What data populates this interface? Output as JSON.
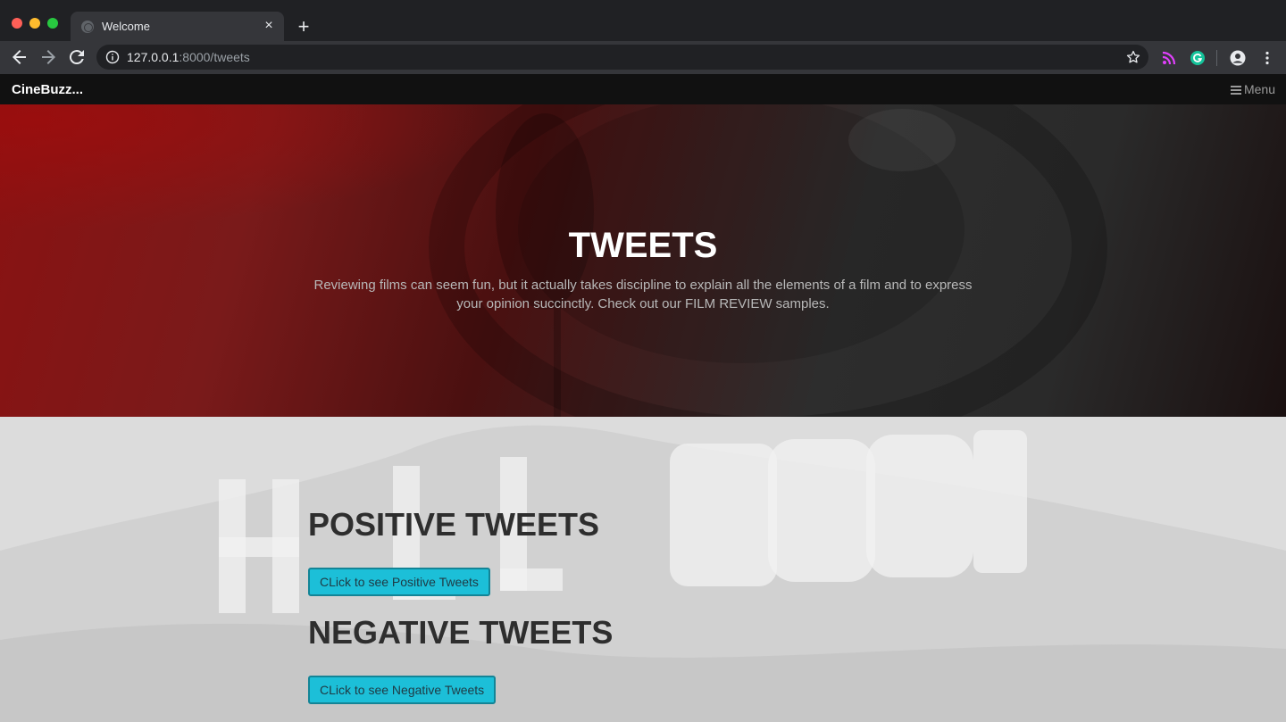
{
  "browser": {
    "tab_title": "Welcome",
    "new_tab_label": "+",
    "close_label": "×",
    "url_host": "127.0.0.1",
    "url_path": ":8000/tweets"
  },
  "site": {
    "brand": "CineBuzz...",
    "menu_label": "Menu"
  },
  "hero": {
    "title": "TWEETS",
    "subtitle": "Reviewing films can seem fun, but it actually takes discipline to explain all the elements of a film and to express your opinion succinctly. Check out our FILM REVIEW samples."
  },
  "sections": {
    "positive": {
      "heading": "POSITIVE TWEETS",
      "button_label": "CLick to see Positive Tweets"
    },
    "negative": {
      "heading": "NEGATIVE TWEETS",
      "button_label": "CLick to see Negative Tweets"
    }
  },
  "colors": {
    "hero_accent": "#8a1212",
    "button_bg": "#1cbfd8",
    "nav_bg": "#111111"
  },
  "icons": [
    "back-arrow-icon",
    "forward-arrow-icon",
    "reload-icon",
    "info-icon",
    "star-icon",
    "rss-icon",
    "grammarly-icon",
    "account-icon",
    "kebab-menu-icon",
    "globe-icon",
    "hamburger-icon"
  ]
}
